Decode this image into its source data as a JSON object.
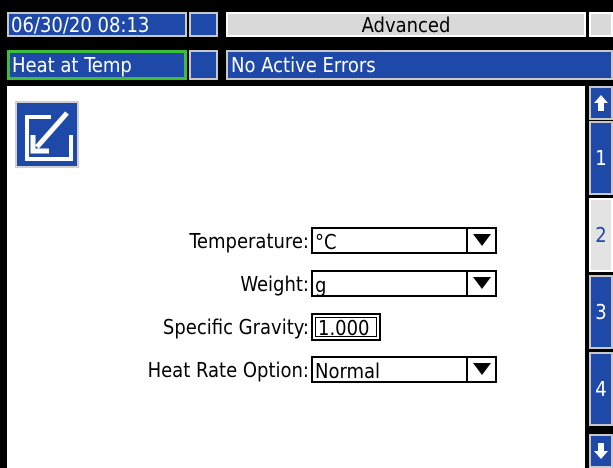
{
  "header": {
    "datetime": "06/30/20 08:13",
    "mode": "Advanced",
    "status": "Heat at Temp",
    "errors": "No Active Errors"
  },
  "form": {
    "temperature": {
      "label": "Temperature:",
      "value": "°C"
    },
    "weight": {
      "label": "Weight:",
      "value": "g"
    },
    "specific_gravity": {
      "label": "Specific Gravity:",
      "value": "1.000"
    },
    "heat_rate": {
      "label": "Heat Rate Option:",
      "value": "Normal"
    }
  },
  "nav": {
    "pages": [
      "1",
      "2",
      "3",
      "4"
    ],
    "selected_page": "2"
  },
  "icons": {
    "edit": "edit-icon",
    "scroll_up": "arrow-up-icon",
    "scroll_down": "arrow-down-icon",
    "dropdown": "chevron-down-icon"
  },
  "colors": {
    "accent_blue": "#1e49a8",
    "status_green": "#3bbf3a",
    "panel_white": "#ffffff",
    "header_gray": "#d9d9d9"
  }
}
